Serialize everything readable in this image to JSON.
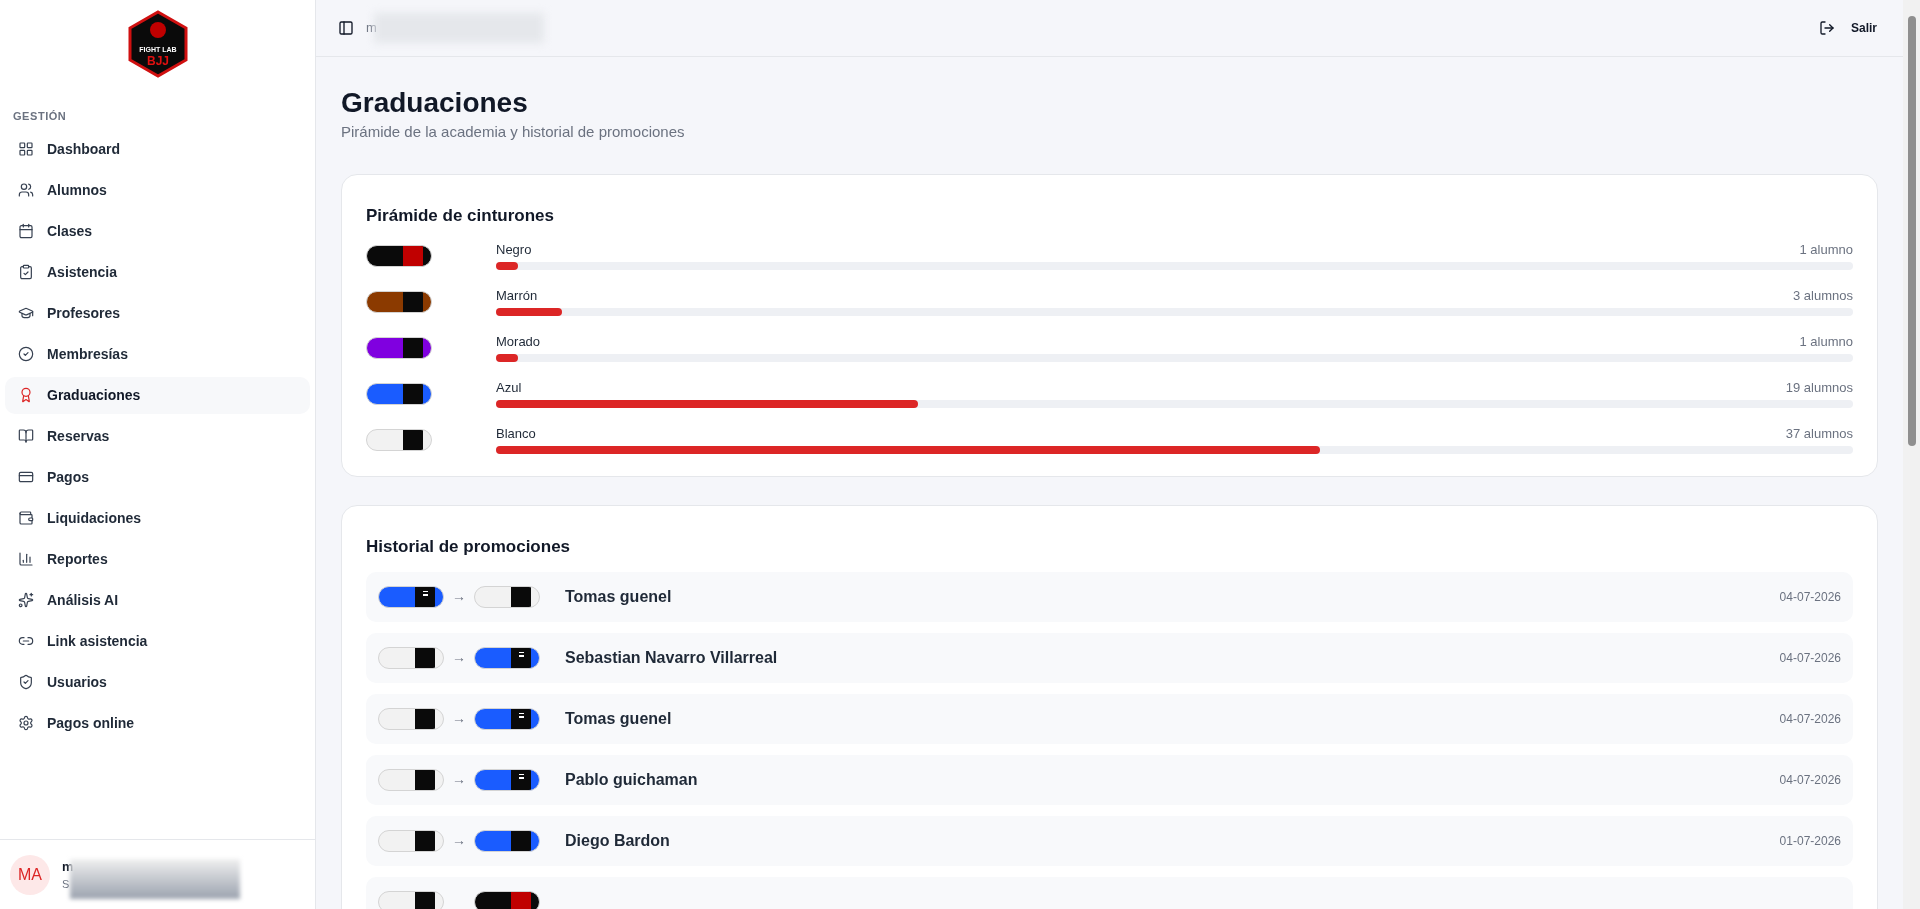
{
  "logo": {
    "line1": "FIGHT LAB",
    "line2": "BJJ"
  },
  "sidebar": {
    "section": "GESTIÓN",
    "items": [
      {
        "label": "Dashboard",
        "selected": false
      },
      {
        "label": "Alumnos",
        "selected": false
      },
      {
        "label": "Clases",
        "selected": false
      },
      {
        "label": "Asistencia",
        "selected": false
      },
      {
        "label": "Profesores",
        "selected": false
      },
      {
        "label": "Membresías",
        "selected": false
      },
      {
        "label": "Graduaciones",
        "selected": true
      },
      {
        "label": "Reservas",
        "selected": false
      },
      {
        "label": "Pagos",
        "selected": false
      },
      {
        "label": "Liquidaciones",
        "selected": false
      },
      {
        "label": "Reportes",
        "selected": false
      },
      {
        "label": "Análisis AI",
        "selected": false
      },
      {
        "label": "Link asistencia",
        "selected": false
      },
      {
        "label": "Usuarios",
        "selected": false
      },
      {
        "label": "Pagos online",
        "selected": false
      }
    ],
    "user": {
      "initials": "MA",
      "name": "m",
      "subtitle": "S"
    }
  },
  "header": {
    "user_email": "m",
    "logout": "Salir"
  },
  "page": {
    "title": "Graduaciones",
    "subtitle": "Pirámide de la academia y historial de promociones"
  },
  "pyramid": {
    "title": "Pirámide de cinturones",
    "belts": [
      {
        "name": "Negro",
        "count": "1 alumno",
        "level": 0.016,
        "belt": {
          "color": "#0a0a0a",
          "kind": "black",
          "stripes": false
        }
      },
      {
        "name": "Marrón",
        "count": "3 alumnos",
        "level": 0.049,
        "belt": {
          "color": "#8b3a00",
          "kind": "colored",
          "stripes": false
        }
      },
      {
        "name": "Morado",
        "count": "1 alumno",
        "level": 0.016,
        "belt": {
          "color": "#8000e0",
          "kind": "colored",
          "stripes": false
        }
      },
      {
        "name": "Azul",
        "count": "19 alumnos",
        "level": 0.311,
        "belt": {
          "color": "#1a5cff",
          "kind": "colored",
          "stripes": false
        }
      },
      {
        "name": "Blanco",
        "count": "37 alumnos",
        "level": 0.607,
        "belt": {
          "color": "#f2f2f2",
          "kind": "colored",
          "stripes": false
        }
      }
    ]
  },
  "history": {
    "title": "Historial de promociones",
    "rows": [
      {
        "from": {
          "color": "#1a5cff",
          "kind": "colored",
          "stripes": true
        },
        "to": {
          "color": "#f2f2f2",
          "kind": "colored",
          "stripes": false
        },
        "arrow": "→",
        "name": "Tomas guenel",
        "date": "04-07-2026"
      },
      {
        "from": {
          "color": "#f2f2f2",
          "kind": "colored",
          "stripes": false
        },
        "to": {
          "color": "#1a5cff",
          "kind": "colored",
          "stripes": true
        },
        "arrow": "→",
        "name": "Sebastian Navarro Villarreal",
        "date": "04-07-2026"
      },
      {
        "from": {
          "color": "#f2f2f2",
          "kind": "colored",
          "stripes": false
        },
        "to": {
          "color": "#1a5cff",
          "kind": "colored",
          "stripes": true
        },
        "arrow": "→",
        "name": "Tomas guenel",
        "date": "04-07-2026"
      },
      {
        "from": {
          "color": "#f2f2f2",
          "kind": "colored",
          "stripes": false
        },
        "to": {
          "color": "#1a5cff",
          "kind": "colored",
          "stripes": true
        },
        "arrow": "→",
        "name": "Pablo guichaman",
        "date": "04-07-2026"
      },
      {
        "from": {
          "color": "#f2f2f2",
          "kind": "colored",
          "stripes": false
        },
        "to": {
          "color": "#1a5cff",
          "kind": "colored",
          "stripes": false
        },
        "arrow": "→",
        "name": "Diego Bardon",
        "date": "01-07-2026"
      },
      {
        "from": {
          "color": "#f2f2f2",
          "kind": "colored",
          "stripes": false
        },
        "to": {
          "color": "#0a0a0a",
          "kind": "black",
          "stripes": false
        }
      }
    ]
  }
}
